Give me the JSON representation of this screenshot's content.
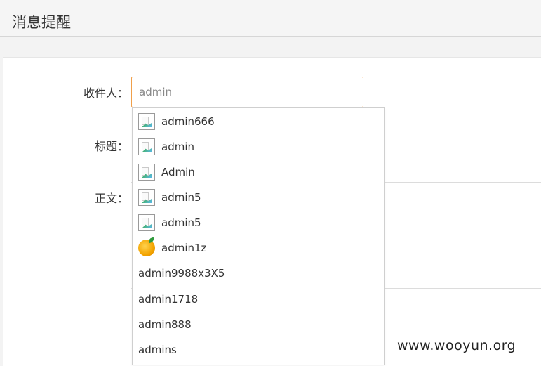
{
  "header": {
    "title": "消息提醒"
  },
  "form": {
    "recipient_label": "收件人：",
    "recipient_value": "admin",
    "subject_label": "标题：",
    "body_label": "正文："
  },
  "suggestions": [
    {
      "label": "admin666",
      "icon": "broken-image-icon"
    },
    {
      "label": "admin",
      "icon": "broken-image-icon"
    },
    {
      "label": "Admin",
      "icon": "broken-image-icon"
    },
    {
      "label": "admin5",
      "icon": "broken-image-icon"
    },
    {
      "label": "admin5",
      "icon": "broken-image-icon"
    },
    {
      "label": "admin1z",
      "icon": "fruit-avatar-icon"
    },
    {
      "label": "admin9988x3X5",
      "icon": ""
    },
    {
      "label": "admin1718",
      "icon": ""
    },
    {
      "label": "admin888",
      "icon": ""
    },
    {
      "label": "admins",
      "icon": ""
    }
  ],
  "watermark": "www.wooyun.org",
  "colors": {
    "focus_border": "#f0a04b"
  }
}
